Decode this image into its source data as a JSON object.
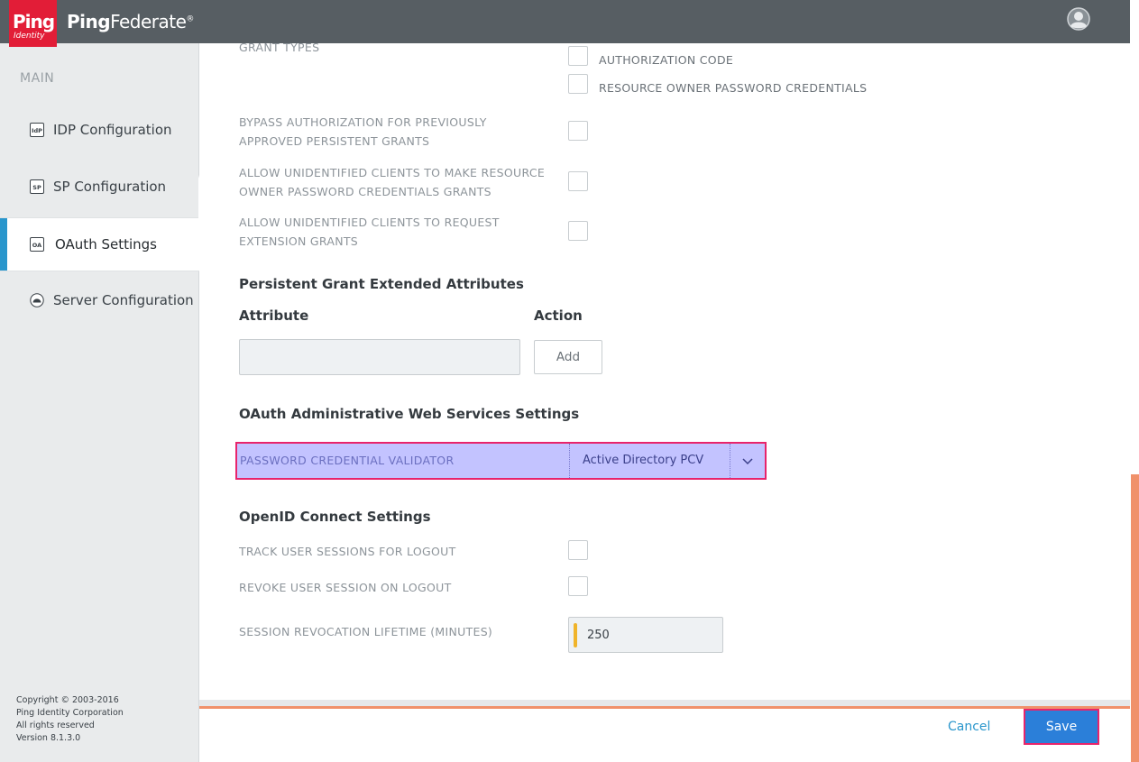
{
  "header": {
    "logo_text": "Ping",
    "logo_sub": "Identity",
    "brand_bold": "Ping",
    "brand_light": "Federate",
    "brand_mark": "®",
    "user_icon": "user-avatar-icon"
  },
  "sidebar": {
    "section": "MAIN",
    "items": [
      {
        "label": "IDP Configuration",
        "icon": "idp-icon",
        "icon_text": "IdP"
      },
      {
        "label": "SP Configuration",
        "icon": "sp-icon",
        "icon_text": "SP"
      },
      {
        "label": "OAuth Settings",
        "icon": "oauth-icon",
        "icon_text": "OA",
        "active": true
      },
      {
        "label": "Server Configuration",
        "icon": "server-icon"
      }
    ],
    "copyright": [
      "Copyright © 2003-2016",
      "Ping Identity Corporation",
      "All rights reserved",
      "Version 8.1.3.0"
    ]
  },
  "grant": {
    "label": "GRANT TYPES",
    "opt_auth_code": "AUTHORIZATION CODE",
    "opt_ropc": "RESOURCE OWNER PASSWORD CREDENTIALS",
    "bypass_label_1": "BYPASS AUTHORIZATION FOR PREVIOUSLY",
    "bypass_label_2": "APPROVED PERSISTENT GRANTS",
    "allow_ropc_1": "ALLOW UNIDENTIFIED CLIENTS TO MAKE RESOURCE",
    "allow_ropc_2": "OWNER PASSWORD CREDENTIALS GRANTS",
    "allow_ext_1": "ALLOW UNIDENTIFIED CLIENTS TO REQUEST",
    "allow_ext_2": "EXTENSION GRANTS"
  },
  "persistent": {
    "title": "Persistent Grant Extended Attributes",
    "col_attribute": "Attribute",
    "col_action": "Action",
    "attribute_value": "",
    "add_label": "Add"
  },
  "admin_ws": {
    "title": "OAuth Administrative Web Services Settings",
    "pcv_label": "PASSWORD CREDENTIAL VALIDATOR",
    "pcv_value": "Active Directory PCV"
  },
  "oidc": {
    "title": "OpenID Connect Settings",
    "track_label": "TRACK USER SESSIONS FOR LOGOUT",
    "revoke_label": "REVOKE USER SESSION ON LOGOUT",
    "lifetime_label": "SESSION REVOCATION LIFETIME (MINUTES)",
    "lifetime_value": "250"
  },
  "footer": {
    "cancel": "Cancel",
    "save": "Save"
  },
  "colors": {
    "accent": "#2996cc",
    "brand_red": "#e21d37",
    "highlight": "#e8246b",
    "save_blue": "#2b7fd9"
  }
}
